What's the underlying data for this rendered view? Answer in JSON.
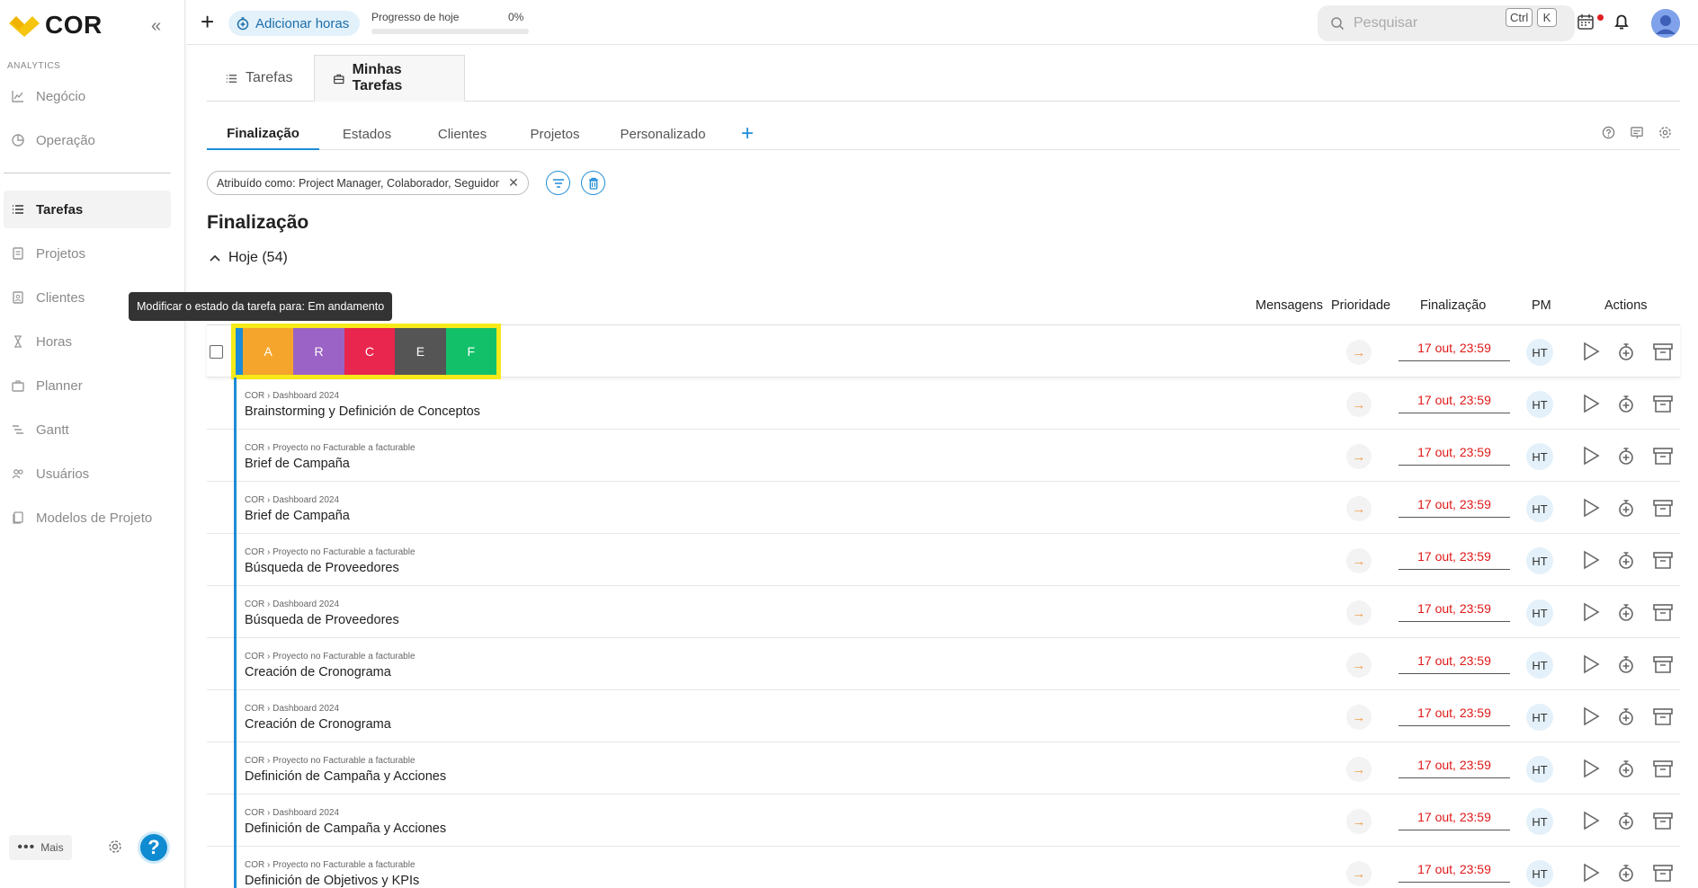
{
  "app": {
    "logo_text": "COR"
  },
  "sidebar": {
    "section_label": "ANALYTICS",
    "analytics_items": [
      {
        "label": "Negócio",
        "icon": "chart-line-icon"
      },
      {
        "label": "Operação",
        "icon": "pie-chart-icon"
      }
    ],
    "items": [
      {
        "label": "Tarefas",
        "icon": "list-icon",
        "active": true
      },
      {
        "label": "Projetos",
        "icon": "document-icon"
      },
      {
        "label": "Clientes",
        "icon": "contact-icon"
      },
      {
        "label": "Horas",
        "icon": "hourglass-icon"
      },
      {
        "label": "Planner",
        "icon": "planner-icon"
      },
      {
        "label": "Gantt",
        "icon": "gantt-icon"
      },
      {
        "label": "Usuários",
        "icon": "users-icon"
      },
      {
        "label": "Modelos de Projeto",
        "icon": "template-icon"
      }
    ],
    "more_label": "Mais"
  },
  "topbar": {
    "add_hours_label": "Adicionar horas",
    "progress_label": "Progresso de hoje",
    "progress_pct": "0%",
    "progress_value": 0,
    "search_placeholder": "Pesquisar",
    "shortcut_key1": "Ctrl",
    "shortcut_key2": "K"
  },
  "main_tabs": [
    {
      "label": "Tarefas",
      "icon": "list-icon"
    },
    {
      "label": "Minhas Tarefas",
      "icon": "briefcase-icon",
      "active": true
    }
  ],
  "view_tabs": [
    {
      "label": "Finalização",
      "active": true
    },
    {
      "label": "Estados"
    },
    {
      "label": "Clientes"
    },
    {
      "label": "Projetos"
    },
    {
      "label": "Personalizado"
    }
  ],
  "filter": {
    "chip_label": "Atribuído como: Project Manager, Colaborador, Seguidor"
  },
  "section_title": "Finalização",
  "group": {
    "label": "Hoje (54)"
  },
  "tooltip": "Modificar o estado da tarefa para: Em andamento",
  "table": {
    "headers": {
      "messages": "Mensagens",
      "priority": "Prioridade",
      "due": "Finalização",
      "pm": "PM",
      "actions": "Actions"
    },
    "status_options": [
      {
        "label": "A",
        "color": "#f5a52c"
      },
      {
        "label": "R",
        "color": "#9b63c5"
      },
      {
        "label": "C",
        "color": "#e8264e"
      },
      {
        "label": "E",
        "color": "#555555"
      },
      {
        "label": "F",
        "color": "#13c06a"
      }
    ],
    "first_row": {
      "due": "17 out, 23:59",
      "pm": "HT"
    },
    "rows": [
      {
        "breadcrumb": "COR › Dashboard 2024",
        "name": "Brainstorming y Definición de Conceptos",
        "due": "17 out, 23:59",
        "pm": "HT"
      },
      {
        "breadcrumb": "COR › Proyecto no Facturable a facturable",
        "name": "Brief de Campaña",
        "due": "17 out, 23:59",
        "pm": "HT"
      },
      {
        "breadcrumb": "COR › Dashboard 2024",
        "name": "Brief de Campaña",
        "due": "17 out, 23:59",
        "pm": "HT"
      },
      {
        "breadcrumb": "COR › Proyecto no Facturable a facturable",
        "name": "Búsqueda de Proveedores",
        "due": "17 out, 23:59",
        "pm": "HT"
      },
      {
        "breadcrumb": "COR › Dashboard 2024",
        "name": "Búsqueda de Proveedores",
        "due": "17 out, 23:59",
        "pm": "HT"
      },
      {
        "breadcrumb": "COR › Proyecto no Facturable a facturable",
        "name": "Creación de Cronograma",
        "due": "17 out, 23:59",
        "pm": "HT"
      },
      {
        "breadcrumb": "COR › Dashboard 2024",
        "name": "Creación de Cronograma",
        "due": "17 out, 23:59",
        "pm": "HT"
      },
      {
        "breadcrumb": "COR › Proyecto no Facturable a facturable",
        "name": "Definición de Campaña y Acciones",
        "due": "17 out, 23:59",
        "pm": "HT"
      },
      {
        "breadcrumb": "COR › Dashboard 2024",
        "name": "Definición de Campaña y Acciones",
        "due": "17 out, 23:59",
        "pm": "HT"
      },
      {
        "breadcrumb": "COR › Proyecto no Facturable a facturable",
        "name": "Definición de Objetivos y KPIs",
        "due": "17 out, 23:59",
        "pm": "HT"
      }
    ]
  }
}
